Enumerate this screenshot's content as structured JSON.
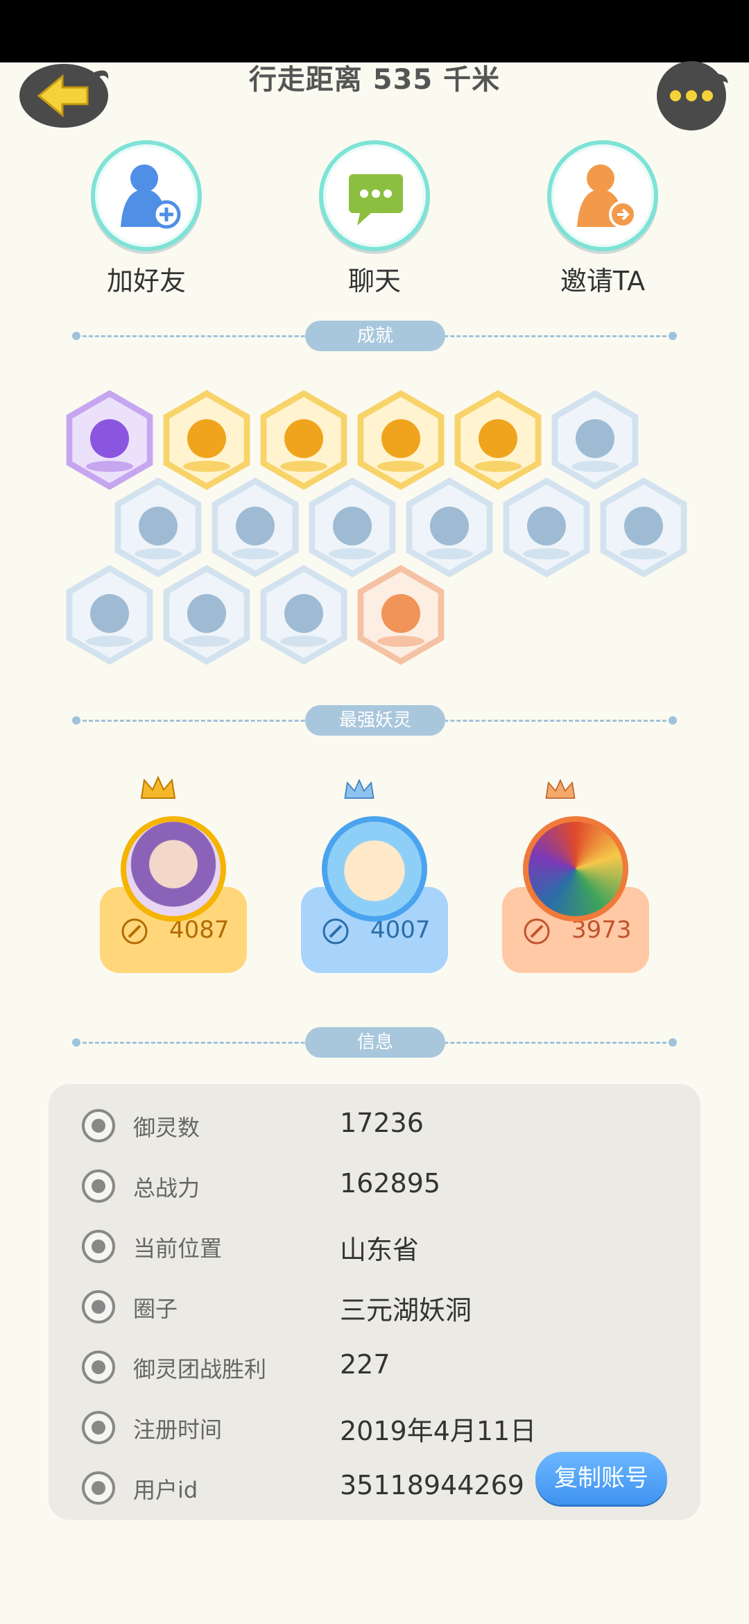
{
  "header": {
    "title": "行走距离 535 千米"
  },
  "actions": [
    {
      "label": "加好友",
      "icon": "add-friend-icon",
      "color": "#4f8fe6"
    },
    {
      "label": "聊天",
      "icon": "chat-icon",
      "color": "#8cbf3f"
    },
    {
      "label": "邀请TA",
      "icon": "invite-icon",
      "color": "#f29a4a"
    }
  ],
  "sections": {
    "achievements": "成就",
    "strongest": "最强妖灵",
    "info": "信息"
  },
  "achievements": [
    {
      "name": "purple-spirit-badge",
      "state": "purple"
    },
    {
      "name": "sun-badge",
      "state": "gold"
    },
    {
      "name": "orb-badge",
      "state": "gold"
    },
    {
      "name": "comet-badge",
      "state": "gold"
    },
    {
      "name": "taiji-badge",
      "state": "gold"
    },
    {
      "name": "sneaker-badge",
      "state": "locked"
    },
    {
      "name": "moon-badge",
      "state": "locked"
    },
    {
      "name": "crystal-badge",
      "state": "locked"
    },
    {
      "name": "monster-badge",
      "state": "locked"
    },
    {
      "name": "cat-spirit-badge",
      "state": "locked"
    },
    {
      "name": "dragon-badge",
      "state": "locked"
    },
    {
      "name": "portal-badge",
      "state": "locked"
    },
    {
      "name": "horned-spirit-badge",
      "state": "locked"
    },
    {
      "name": "ghost-badge",
      "state": "locked"
    },
    {
      "name": "book-fox-badge",
      "state": "locked"
    },
    {
      "name": "cart-badge",
      "state": "orange"
    }
  ],
  "strongest": [
    {
      "power": "4087",
      "color": "#ffd77a",
      "text": "#b36a00",
      "ring": "#f5b400"
    },
    {
      "power": "4007",
      "color": "#a8d3fb",
      "text": "#2a6ea8",
      "ring": "#4aa3ef"
    },
    {
      "power": "3973",
      "color": "#ffc9a6",
      "text": "#c0542b",
      "ring": "#f07a3a"
    }
  ],
  "info": {
    "rows": [
      {
        "key": "御灵数",
        "value": "17236",
        "icon": "spirit-count-icon"
      },
      {
        "key": "总战力",
        "value": "162895",
        "icon": "sword-icon"
      },
      {
        "key": "当前位置",
        "value": "山东省",
        "icon": "location-pin-icon"
      },
      {
        "key": "圈子",
        "value": "三元湖妖洞",
        "icon": "circle-group-icon"
      },
      {
        "key": "御灵团战胜利",
        "value": "227",
        "icon": "trophy-icon"
      },
      {
        "key": "注册时间",
        "value": "2019年4月11日",
        "icon": "clock-icon"
      },
      {
        "key": "用户id",
        "value": "35118944269",
        "icon": "id-card-icon"
      }
    ],
    "copy_button": "复制账号"
  }
}
